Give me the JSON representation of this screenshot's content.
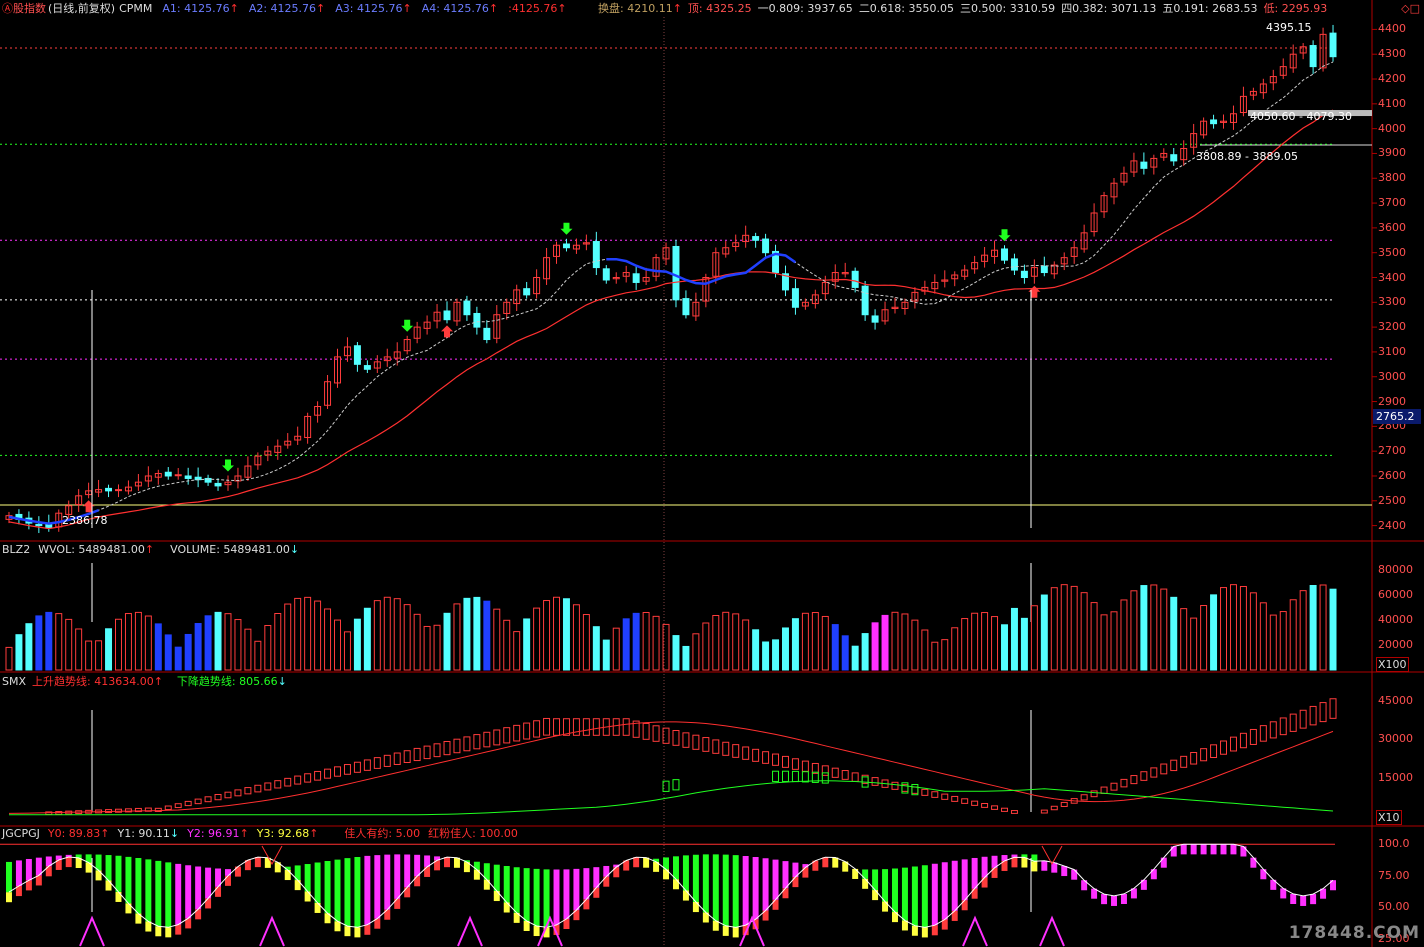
{
  "main_header": {
    "title": "股指数",
    "mode": "(日线,前复权)",
    "indicator": "CPMM",
    "a1": "A1: 4125.76",
    "a2": "A2: 4125.76",
    "a3": "A3: 4125.76",
    "a4": "A4: 4125.76",
    "a5": ":4125.76",
    "panpan": "换盘: 4210.11",
    "ding": "顶: 4325.25",
    "g1": "一0.809: 3937.65",
    "g2": "二0.618: 3550.05",
    "g3": "三0.500: 3310.59",
    "g4": "四0.382: 3071.13",
    "g5": "五0.191: 2683.53",
    "di": "低: 2295.93"
  },
  "price_axis": [
    "4400",
    "4300",
    "4200",
    "4100",
    "4000",
    "3900",
    "3800",
    "3700",
    "3600",
    "3500",
    "3400",
    "3300",
    "3200",
    "3100",
    "3000",
    "2900",
    "2800",
    "2700",
    "2600",
    "2500",
    "2400"
  ],
  "price_highlight": "2765.2",
  "price_annotations": {
    "high": "4395.15",
    "low": "2386.78",
    "range1": "4050.60 - 4079.30",
    "range2": "3808.89 - 3889.05"
  },
  "vol_header": {
    "name": "BLZ2",
    "wvol": "WVOL: 5489481.00",
    "volume": "VOLUME: 5489481.00"
  },
  "vol_axis": [
    "80000",
    "60000",
    "40000",
    "20000"
  ],
  "vol_unit": "X100",
  "smx_header": {
    "name": "SMX",
    "up": "上升趋势线: 413634.00",
    "down": "下降趋势线: 805.66"
  },
  "smx_axis": [
    "45000",
    "30000",
    "15000"
  ],
  "smx_unit": "X10",
  "jg_header": {
    "name": "JGCPGJ",
    "y0": "Y0: 89.83",
    "y1": "Y1: 90.11",
    "y2": "Y2: 96.91",
    "y3": "Y3: 92.68",
    "jr": "佳人有约: 5.00",
    "hf": "红粉佳人: 100.00"
  },
  "jg_axis": [
    "100.0",
    "75.00",
    "50.00",
    "25.00"
  ],
  "watermark": "178448.COM",
  "colors": {
    "up": "#ff3c3c",
    "down": "#54ffff",
    "blue": "#2040ff",
    "green": "#20ff20",
    "yellow": "#ffff40",
    "magenta": "#ff30ff",
    "red_line": "#ff3030"
  },
  "chart_data": {
    "type": "candlestick",
    "price_ylim": [
      2350,
      4450
    ],
    "closes": [
      2440,
      2425,
      2410,
      2400,
      2390,
      2450,
      2480,
      2520,
      2540,
      2545,
      2540,
      2545,
      2555,
      2575,
      2600,
      2610,
      2600,
      2605,
      2590,
      2585,
      2575,
      2560,
      2575,
      2600,
      2640,
      2680,
      2700,
      2720,
      2740,
      2760,
      2840,
      2880,
      2980,
      3080,
      3120,
      3050,
      3030,
      3060,
      3080,
      3100,
      3150,
      3200,
      3220,
      3260,
      3230,
      3300,
      3250,
      3200,
      3150,
      3250,
      3300,
      3350,
      3330,
      3400,
      3480,
      3530,
      3520,
      3530,
      3540,
      3440,
      3390,
      3400,
      3420,
      3380,
      3400,
      3480,
      3520,
      3310,
      3250,
      3300,
      3400,
      3500,
      3520,
      3540,
      3570,
      3550,
      3500,
      3420,
      3350,
      3280,
      3300,
      3330,
      3380,
      3420,
      3420,
      3360,
      3250,
      3220,
      3270,
      3280,
      3300,
      3340,
      3360,
      3380,
      3390,
      3410,
      3430,
      3460,
      3490,
      3510,
      3470,
      3430,
      3400,
      3440,
      3420,
      3450,
      3480,
      3520,
      3580,
      3660,
      3730,
      3780,
      3820,
      3870,
      3840,
      3880,
      3900,
      3870,
      3920,
      3980,
      4030,
      4020,
      4030,
      4060,
      4130,
      4150,
      4180,
      4210,
      4250,
      4300,
      4330,
      4250,
      4380,
      4290
    ],
    "volume_ylim": [
      0,
      90000
    ],
    "smx_ylim": [
      0,
      50000
    ],
    "jg_ylim": [
      20,
      105
    ]
  }
}
